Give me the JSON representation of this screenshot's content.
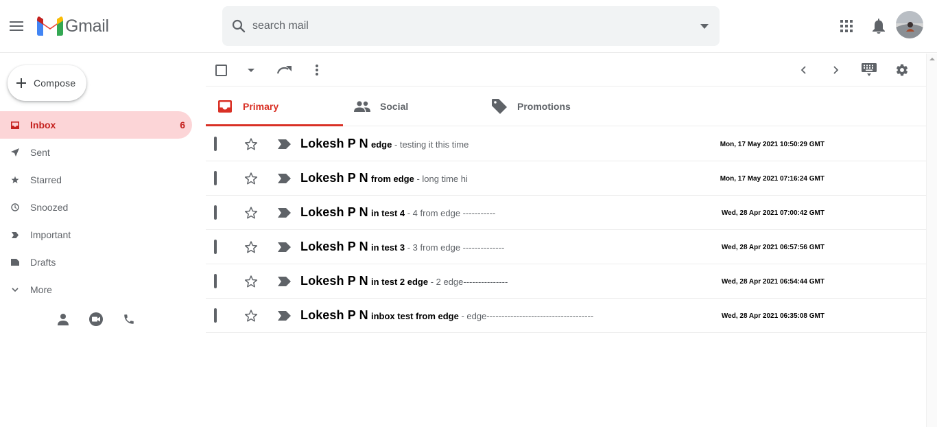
{
  "header": {
    "logo_text": "Gmail",
    "search_placeholder": "search mail"
  },
  "sidebar": {
    "compose_label": "Compose",
    "items": [
      {
        "label": "Inbox",
        "count": "6",
        "icon": "inbox-icon"
      },
      {
        "label": "Sent",
        "count": "",
        "icon": "send-icon"
      },
      {
        "label": "Starred",
        "count": "",
        "icon": "star-icon"
      },
      {
        "label": "Snoozed",
        "count": "",
        "icon": "clock-icon"
      },
      {
        "label": "Important",
        "count": "",
        "icon": "label-important-icon"
      },
      {
        "label": "Drafts",
        "count": "",
        "icon": "draft-icon"
      },
      {
        "label": "More",
        "count": "",
        "icon": "chevron-down-icon"
      }
    ]
  },
  "tabs": [
    {
      "label": "Primary",
      "icon": "inbox-icon"
    },
    {
      "label": "Social",
      "icon": "people-icon"
    },
    {
      "label": "Promotions",
      "icon": "tag-icon"
    }
  ],
  "emails": [
    {
      "sender": "Lokesh P N",
      "subject": "edge",
      "snippet": " - testing it this time",
      "date": "Mon, 17 May 2021 10:50:29 GMT"
    },
    {
      "sender": "Lokesh P N",
      "subject": "from edge",
      "snippet": " - long time hi",
      "date": "Mon, 17 May 2021 07:16:24 GMT"
    },
    {
      "sender": "Lokesh P N",
      "subject": "in test 4",
      "snippet": " - 4 from edge -----------",
      "date": "Wed, 28 Apr 2021 07:00:42 GMT"
    },
    {
      "sender": "Lokesh P N",
      "subject": "in test 3",
      "snippet": " - 3 from edge --------------",
      "date": "Wed, 28 Apr 2021 06:57:56 GMT"
    },
    {
      "sender": "Lokesh P N",
      "subject": "in test 2 edge",
      "snippet": " - 2 edge---------------",
      "date": "Wed, 28 Apr 2021 06:54:44 GMT"
    },
    {
      "sender": "Lokesh P N",
      "subject": "inbox test from edge",
      "snippet": " - edge------------------------------------",
      "date": "Wed, 28 Apr 2021 06:35:08 GMT"
    }
  ],
  "colors": {
    "accent": "#d93025",
    "inbox_active_bg": "#fcd5d7",
    "icon_gray": "#5f6368"
  }
}
